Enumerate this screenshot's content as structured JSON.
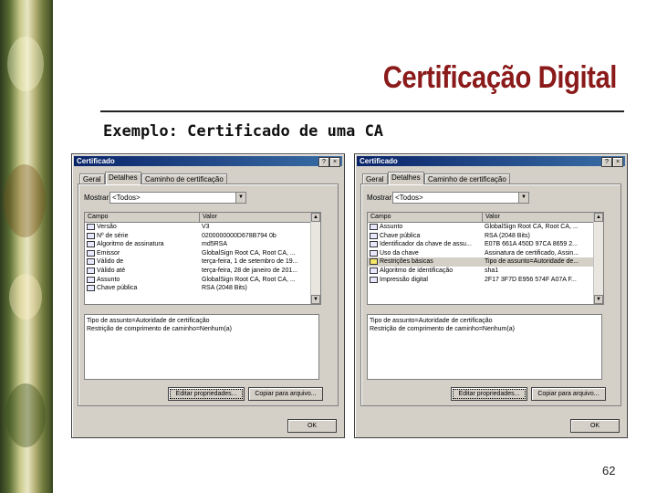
{
  "slide": {
    "title": "Certificação Digital",
    "subtitle": "Exemplo: Certificado de uma CA",
    "page_number": "62"
  },
  "dialogs": [
    {
      "window_title": "Certificado",
      "help_button": "?",
      "close_button": "×",
      "tabs": [
        "Geral",
        "Detalhes",
        "Caminho de certificação"
      ],
      "active_tab": 1,
      "show_label": "Mostrar:",
      "show_value": "<Todos>",
      "columns": [
        "Campo",
        "Valor"
      ],
      "rows": [
        {
          "field": "Versão",
          "value": "V3",
          "selected": false
        },
        {
          "field": "Nº de série",
          "value": "0200000000D678B794 0b",
          "selected": false
        },
        {
          "field": "Algoritmo de assinatura",
          "value": "md5RSA",
          "selected": false
        },
        {
          "field": "Emissor",
          "value": "GlobalSign Root CA, Root CA, ...",
          "selected": false
        },
        {
          "field": "Válido de",
          "value": "terça-feira, 1 de setembro de 19...",
          "selected": false
        },
        {
          "field": "Válido até",
          "value": "terça-feira, 28 de janeiro de 201...",
          "selected": false
        },
        {
          "field": "Assunto",
          "value": "GlobalSign Root CA, Root CA, ...",
          "selected": false
        },
        {
          "field": "Chave pública",
          "value": "RSA (2048 Bits)",
          "selected": false
        }
      ],
      "detail_lines": [
        "Tipo de assunto=Autoridade de certificação",
        "Restrição de comprimento de caminho=Nenhum(a)"
      ],
      "edit_button": "Editar propriedades...",
      "copy_button": "Copiar para arquivo...",
      "ok_button": "OK"
    },
    {
      "window_title": "Certificado",
      "help_button": "?",
      "close_button": "×",
      "tabs": [
        "Geral",
        "Detalhes",
        "Caminho de certificação"
      ],
      "active_tab": 1,
      "show_label": "Mostrar:",
      "show_value": "<Todos>",
      "columns": [
        "Campo",
        "Valor"
      ],
      "rows": [
        {
          "field": "Assunto",
          "value": "GlobalSign Root CA, Root CA, ...",
          "selected": false
        },
        {
          "field": "Chave pública",
          "value": "RSA (2048 Bits)",
          "selected": false
        },
        {
          "field": "Identificador da chave de assu...",
          "value": "E07B 661A 450D 97CA 8659 2...",
          "selected": false
        },
        {
          "field": "Uso da chave",
          "value": "Assinatura de certificado, Assin...",
          "selected": false
        },
        {
          "field": "Restrições básicas",
          "value": "Tipo de assunto=Autoridade de...",
          "selected": true
        },
        {
          "field": "Algoritmo de identificação",
          "value": "sha1",
          "selected": false
        },
        {
          "field": "Impressão digital",
          "value": "2F17 3F7D E956 574F A07A F...",
          "selected": false
        }
      ],
      "detail_lines": [
        "Tipo de assunto=Autoridade de certificação",
        "Restrição de comprimento de caminho=Nenhum(a)"
      ],
      "edit_button": "Editar propriedades...",
      "copy_button": "Copiar para arquivo...",
      "ok_button": "OK"
    }
  ]
}
